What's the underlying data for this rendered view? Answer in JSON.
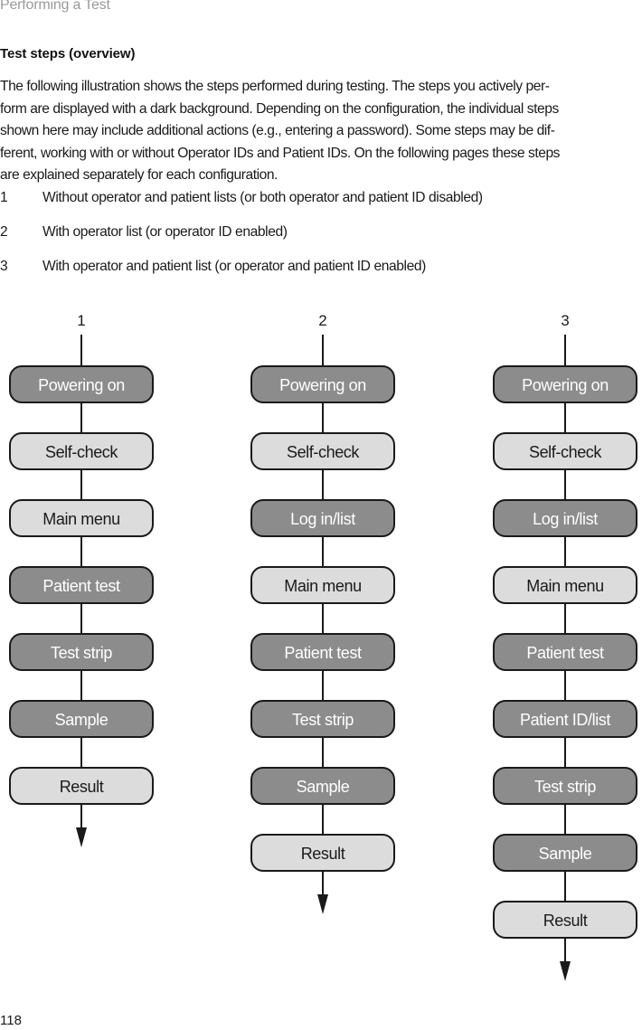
{
  "header": {
    "running_title": "Performing a Test"
  },
  "section": {
    "title": "Test steps (overview)",
    "intro_lines": [
      "The following illustration shows the steps performed during testing. The steps you actively per-",
      "form are displayed with a dark background. Depending on the configuration, the individual steps",
      "shown here may include additional actions (e.g., entering a password). Some steps may be dif-",
      "ferent, working with or without Operator IDs and Patient IDs. On the following pages these steps",
      "are explained separately for each configuration."
    ],
    "configurations": [
      {
        "num": "1",
        "text": "Without operator and patient lists (or both operator and patient ID disabled)"
      },
      {
        "num": "2",
        "text": "With operator list (or operator ID enabled)"
      },
      {
        "num": "3",
        "text": "With operator and patient list (or operator and patient ID enabled)"
      }
    ]
  },
  "colors": {
    "dark_step": "#8c8c8c",
    "light_step": "#dcdcdc",
    "dark_text": "#ffffff",
    "light_text": "#1a1a1a",
    "stroke": "#1a1a1a"
  },
  "flowcharts": [
    {
      "label": "1",
      "steps": [
        {
          "text": "Powering on",
          "dark": true
        },
        {
          "text": "Self-check",
          "dark": false
        },
        {
          "text": "Main menu",
          "dark": false
        },
        {
          "text": "Patient test",
          "dark": true
        },
        {
          "text": "Test strip",
          "dark": true
        },
        {
          "text": "Sample",
          "dark": true
        },
        {
          "text": "Result",
          "dark": false
        }
      ]
    },
    {
      "label": "2",
      "steps": [
        {
          "text": "Powering on",
          "dark": true
        },
        {
          "text": "Self-check",
          "dark": false
        },
        {
          "text": "Log in/list",
          "dark": true
        },
        {
          "text": "Main menu",
          "dark": false
        },
        {
          "text": "Patient test",
          "dark": true
        },
        {
          "text": "Test strip",
          "dark": true
        },
        {
          "text": "Sample",
          "dark": true
        },
        {
          "text": "Result",
          "dark": false
        }
      ]
    },
    {
      "label": "3",
      "steps": [
        {
          "text": "Powering on",
          "dark": true
        },
        {
          "text": "Self-check",
          "dark": false
        },
        {
          "text": "Log in/list",
          "dark": true
        },
        {
          "text": "Main menu",
          "dark": false
        },
        {
          "text": "Patient test",
          "dark": true
        },
        {
          "text": "Patient ID/list",
          "dark": true
        },
        {
          "text": "Test strip",
          "dark": true
        },
        {
          "text": "Sample",
          "dark": true
        },
        {
          "text": "Result",
          "dark": false
        }
      ]
    }
  ],
  "footer": {
    "page_number": "118"
  }
}
